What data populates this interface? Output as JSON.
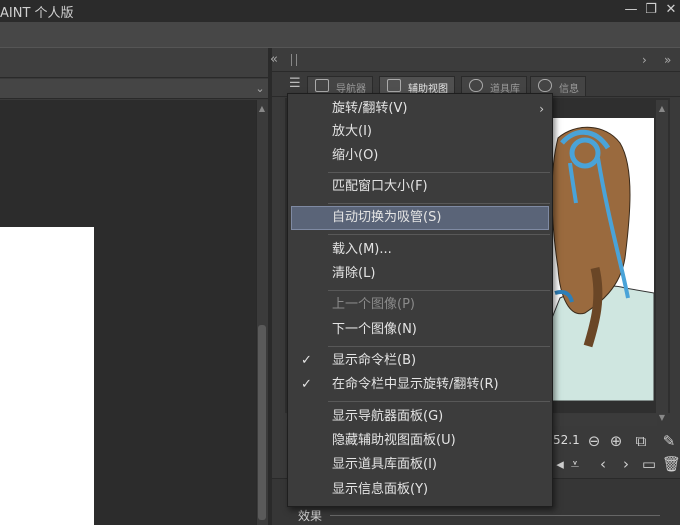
{
  "window": {
    "title": "AINT 个人版",
    "minimize_glyph": "—",
    "restore_glyph": "❐",
    "close_glyph": "✕"
  },
  "right_panel": {
    "collapse_glyph": "«",
    "expand_glyph": "›",
    "more_glyph": "»",
    "tabs": [
      {
        "label": "导航器",
        "active": false
      },
      {
        "label": "辅助视图",
        "active": true
      },
      {
        "label": "道具库",
        "active": false
      },
      {
        "label": "信息",
        "active": false
      }
    ],
    "zoom_value": "52.1",
    "effects_label": "效果"
  },
  "context_menu": {
    "items": [
      {
        "label": "旋转/翻转(V)",
        "submenu": true,
        "enabled": true
      },
      {
        "label": "放大(I)",
        "enabled": true
      },
      {
        "label": "缩小(O)",
        "enabled": true
      },
      {
        "label": "匹配窗口大小(F)",
        "enabled": true
      },
      {
        "label": "自动切换为吸管(S)",
        "enabled": true,
        "highlighted": true
      },
      {
        "label": "载入(M)...",
        "enabled": true
      },
      {
        "label": "清除(L)",
        "enabled": true
      },
      {
        "label": "上一个图像(P)",
        "enabled": false
      },
      {
        "label": "下一个图像(N)",
        "enabled": true
      },
      {
        "label": "显示命令栏(B)",
        "enabled": true,
        "checked": true
      },
      {
        "label": "在命令栏中显示旋转/翻转(R)",
        "enabled": true,
        "checked": true
      },
      {
        "label": "显示导航器面板(G)",
        "enabled": true
      },
      {
        "label": "隐藏辅助视图面板(U)",
        "enabled": true
      },
      {
        "label": "显示道具库面板(I)",
        "enabled": true
      },
      {
        "label": "显示信息面板(Y)",
        "enabled": true
      }
    ],
    "check_glyph": "✓",
    "submenu_glyph": "›"
  },
  "colors": {
    "highlight": "#5a6478",
    "ribbon_blue": "#4aa3d8",
    "hair_brown": "#9a6a3e",
    "robe_mint": "#cfe6e0"
  }
}
